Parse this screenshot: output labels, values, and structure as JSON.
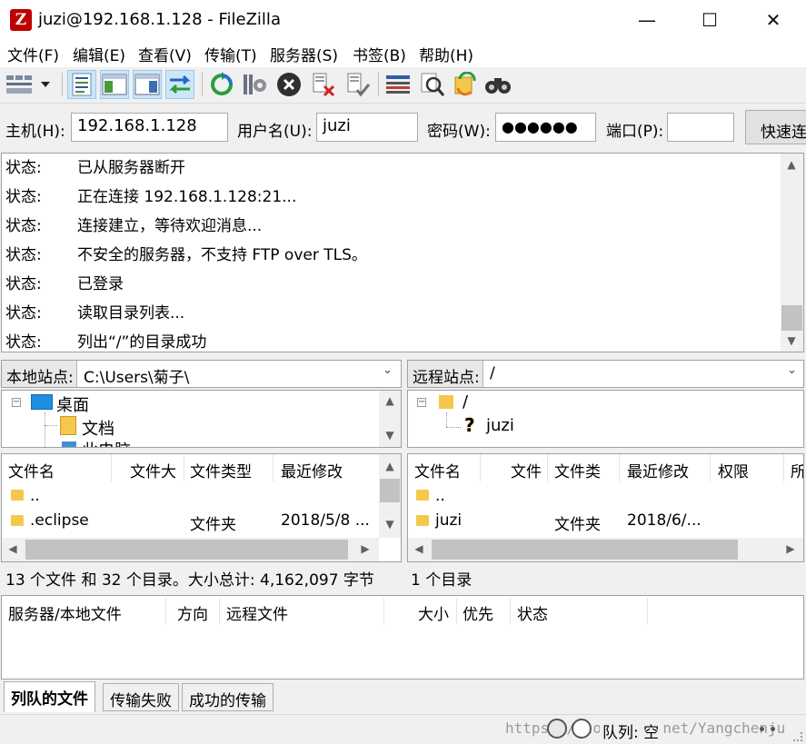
{
  "window": {
    "title": "juzi@192.168.1.128 - FileZilla",
    "app_logo": "Z",
    "controls": {
      "minimize": "—",
      "maximize": "☐",
      "close": "✕"
    }
  },
  "menu": [
    "文件(F)",
    "编辑(E)",
    "查看(V)",
    "传输(T)",
    "服务器(S)",
    "书签(B)",
    "帮助(H)"
  ],
  "toolbar": {
    "icons": [
      "site-manager-icon",
      "dropdown-arrow-icon",
      "toggle-log-icon",
      "toggle-local-tree-icon",
      "toggle-remote-tree-icon",
      "toggle-queue-icon",
      "refresh-icon",
      "process-queue-icon",
      "cancel-icon",
      "disconnect-icon",
      "reconnect-icon",
      "filter-icon",
      "compare-icon",
      "sync-browse-icon",
      "search-icon"
    ]
  },
  "quickconnect": {
    "host_label": "主机(H):",
    "host_value": "192.168.1.128",
    "user_label": "用户名(U):",
    "user_value": "juzi",
    "pass_label": "密码(W):",
    "pass_value": "●●●●●●",
    "port_label": "端口(P):",
    "port_value": "",
    "button": "快速连接"
  },
  "log": [
    {
      "label": "状态:",
      "message": "已从服务器断开"
    },
    {
      "label": "状态:",
      "message": "正在连接 192.168.1.128:21..."
    },
    {
      "label": "状态:",
      "message": "连接建立，等待欢迎消息..."
    },
    {
      "label": "状态:",
      "message": "不安全的服务器，不支持 FTP over TLS。"
    },
    {
      "label": "状态:",
      "message": "已登录"
    },
    {
      "label": "状态:",
      "message": "读取目录列表..."
    },
    {
      "label": "状态:",
      "message": "列出“/”的目录成功"
    }
  ],
  "local": {
    "label": "本地站点:",
    "path": "C:\\Users\\菊子\\",
    "tree": [
      "桌面",
      "文档",
      "此电脑"
    ],
    "columns": [
      "文件名",
      "文件大",
      "文件类型",
      "最近修改"
    ],
    "rows": [
      {
        "name": "..",
        "size": "",
        "type": "",
        "modified": ""
      },
      {
        "name": ".eclipse",
        "size": "",
        "type": "文件夹",
        "modified": "2018/5/8 ..."
      }
    ],
    "status": "13 个文件 和 32 个目录。大小总计: 4,162,097 字节"
  },
  "remote": {
    "label": "远程站点:",
    "path": "/",
    "tree": [
      "/",
      "juzi"
    ],
    "columns": [
      "文件名",
      "文件",
      "文件类",
      "最近修改",
      "权限",
      "所"
    ],
    "rows": [
      {
        "name": "..",
        "size": "",
        "type": "",
        "modified": ""
      },
      {
        "name": "juzi",
        "size": "",
        "type": "文件夹",
        "modified": "2018/6/..."
      }
    ],
    "status": "1 个目录"
  },
  "queue": {
    "columns": [
      "服务器/本地文件",
      "方向",
      "远程文件",
      "大小",
      "优先",
      "状态"
    ],
    "tabs": [
      "列队的文件",
      "传输失败",
      "成功的传输"
    ]
  },
  "statusbar": {
    "watermark": "https://blog.csdn.net/Yangchenju",
    "queue_text": "队列: 空"
  },
  "colors": {
    "accent_selected": "#cde6f7",
    "logo_red": "#bf0000",
    "folder": "#f5c84c"
  }
}
